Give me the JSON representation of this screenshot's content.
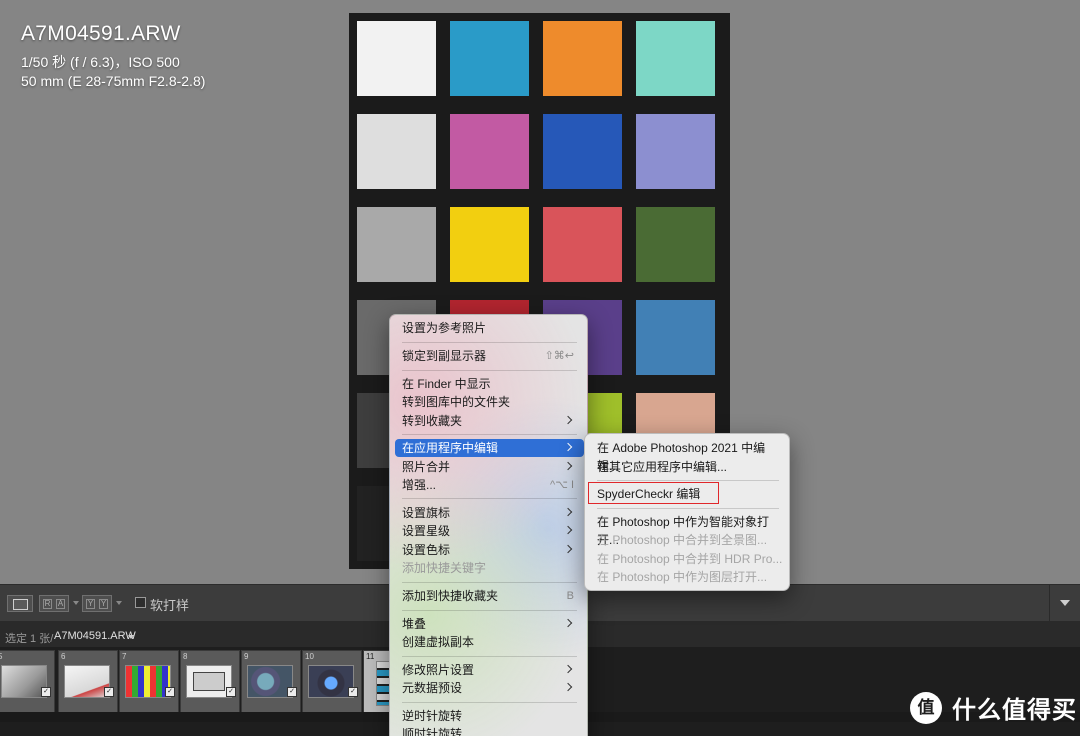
{
  "photo_info": {
    "filename": "A7M04591.ARW",
    "exposure": "1/50 秒 (f / 6.3)，ISO 500",
    "lens": "50 mm (E 28-75mm F2.8-2.8)"
  },
  "color_checker": {
    "patch_colors": [
      [
        "#f2f2f2",
        "#2a9bc8",
        "#ee8b2c",
        "#7dd7c6"
      ],
      [
        "#dedede",
        "#c25aa3",
        "#2658b8",
        "#8c8fd0"
      ],
      [
        "#a9a9a9",
        "#f2cf10",
        "#d9545a",
        "#4a6b34"
      ],
      [
        "#6a6a6a",
        "#b2252f",
        "#5a3f8a",
        "#4180b5"
      ],
      [
        "#3e3e3e",
        "#3a3a3a",
        "#9fbf2a",
        "#d8a690"
      ],
      [
        "#222222",
        "#222222",
        "#222222",
        "#222222"
      ]
    ]
  },
  "toolbar": {
    "softproof_label": "软打样",
    "compare_label": "R|A",
    "survey_label": "Y|Y"
  },
  "filmstrip_header": {
    "selection_text": "选定 1 张/",
    "filename": "A7M04591.ARW"
  },
  "filmstrip": {
    "cells": [
      {
        "num": "5",
        "badge": "✓"
      },
      {
        "num": "6",
        "badge": "✓"
      },
      {
        "num": "7",
        "badge": "✓"
      },
      {
        "num": "8",
        "badge": "✓"
      },
      {
        "num": "9",
        "badge": "✓"
      },
      {
        "num": "10",
        "badge": "✓"
      },
      {
        "num": "11",
        "badge": ""
      }
    ]
  },
  "context_menu": {
    "items": [
      {
        "label": "设置为参考照片"
      },
      {
        "label": "锁定到副显示器",
        "shortcut": "⇧⌘↩"
      },
      {
        "label": "在 Finder 中显示"
      },
      {
        "label": "转到图库中的文件夹"
      },
      {
        "label": "转到收藏夹"
      },
      {
        "label": "在应用程序中编辑"
      },
      {
        "label": "照片合并"
      },
      {
        "label": "增强...",
        "shortcut": "^⌥ I"
      },
      {
        "label": "设置旗标"
      },
      {
        "label": "设置星级"
      },
      {
        "label": "设置色标"
      },
      {
        "label": "添加快捷关键字"
      },
      {
        "label": "添加到快捷收藏夹",
        "shortcut": "B"
      },
      {
        "label": "堆叠"
      },
      {
        "label": "创建虚拟副本"
      },
      {
        "label": "修改照片设置"
      },
      {
        "label": "元数据预设"
      },
      {
        "label": "逆时针旋转"
      },
      {
        "label": "顺时针旋转"
      }
    ]
  },
  "submenu": {
    "items": [
      {
        "label": "在 Adobe Photoshop 2021 中编辑..."
      },
      {
        "label": "在其它应用程序中编辑..."
      },
      {
        "label": "SpyderCheckr 编辑"
      },
      {
        "label": "在 Photoshop 中作为智能对象打开..."
      },
      {
        "label": "在 Photoshop 中合并到全景图..."
      },
      {
        "label": "在 Photoshop 中合并到 HDR Pro..."
      },
      {
        "label": "在 Photoshop 中作为图层打开..."
      }
    ]
  },
  "watermark": {
    "icon_text": "值",
    "text": "什么值得买"
  }
}
